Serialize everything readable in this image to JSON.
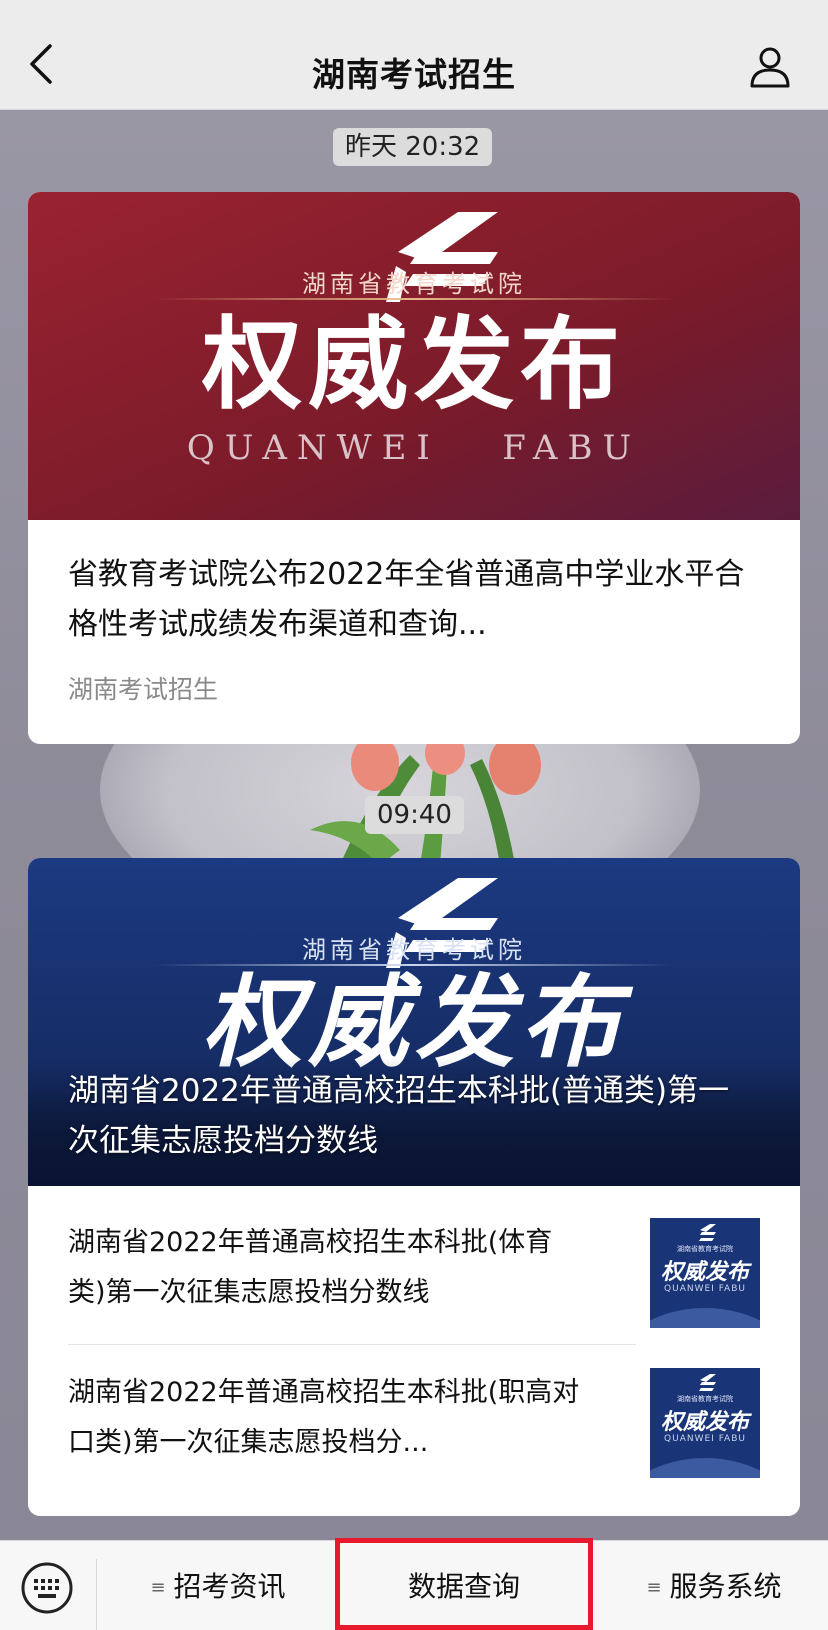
{
  "header": {
    "title": "湖南考试招生",
    "back_icon": "chevron-left-icon",
    "profile_icon": "person-icon"
  },
  "messages": [
    {
      "timestamp": "昨天 20:32",
      "banner": {
        "logo_org": "湖南省教育考试院",
        "headline": "权威发布",
        "pinyin": "QUANWEI   FABU",
        "theme_color": "#8a1f2a"
      },
      "title": "省教育考试院公布2022年全省普通高中学业水平合格性考试成绩发布渠道和查询...",
      "source": "湖南考试招生"
    },
    {
      "timestamp": "09:40",
      "banner": {
        "logo_org": "湖南省教育考试院",
        "headline": "权威发布",
        "pinyin": "QUANWEI   FABU",
        "theme_color": "#1a2f6e"
      },
      "overlay_title": "湖南省2022年普通高校招生本科批(普通类)第一次征集志愿投档分数线",
      "items": [
        {
          "title": "湖南省2022年普通高校招生本科批(体育类)第一次征集志愿投档分数线",
          "thumb": {
            "org": "湖南省教育考试院",
            "headline": "权威发布",
            "pinyin": "QUANWEI FABU"
          }
        },
        {
          "title": "湖南省2022年普通高校招生本科批(职高对口类)第一次征集志愿投档分...",
          "thumb": {
            "org": "湖南省教育考试院",
            "headline": "权威发布",
            "pinyin": "QUANWEI FABU"
          }
        }
      ]
    }
  ],
  "bottom_menu": {
    "keyboard_icon": "keyboard-icon",
    "menu_glyph": "≡",
    "items": [
      {
        "label": "招考资讯"
      },
      {
        "label": "数据查询",
        "highlighted": true
      },
      {
        "label": "服务系统"
      }
    ],
    "highlight_color": "#e8192c"
  }
}
